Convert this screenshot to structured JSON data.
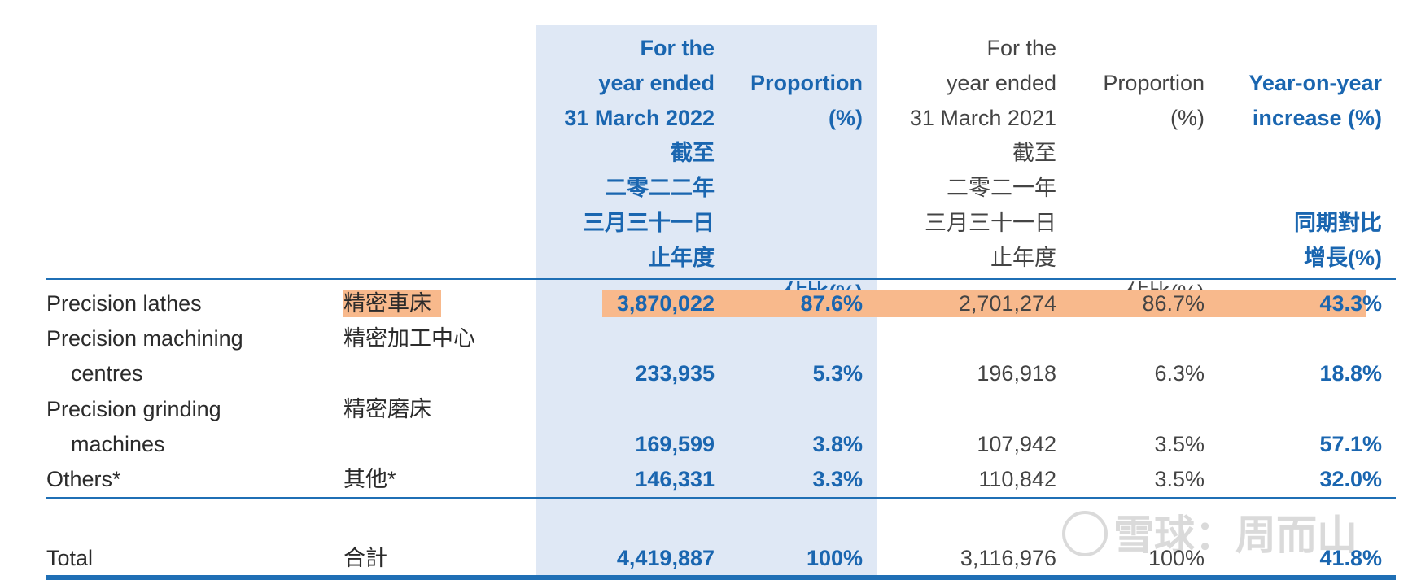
{
  "header": {
    "col_2022": "For the\nyear ended\n31 March 2022\n截至\n二零二二年\n三月三十一日\n止年度",
    "col_prop_2022": "Proportion\n(%)\n\n\n\n\n佔比(%)",
    "col_2021": "For the\nyear ended\n31 March 2021\n截至\n二零二一年\n三月三十一日\n止年度",
    "col_prop_2021": "Proportion\n(%)\n\n\n\n\n佔比(%)",
    "col_yoy": "Year-on-year\nincrease (%)\n\n\n同期對比\n增長(%)"
  },
  "rows": [
    {
      "en": "Precision lathes",
      "zh": "精密車床",
      "v2022": "3,870,022",
      "p2022": "87.6%",
      "v2021": "2,701,274",
      "p2021": "86.7%",
      "yoy": "43.3%"
    },
    {
      "en": "Precision machining",
      "en2": "centres",
      "zh": "精密加工中心",
      "v2022": "233,935",
      "p2022": "5.3%",
      "v2021": "196,918",
      "p2021": "6.3%",
      "yoy": "18.8%"
    },
    {
      "en": "Precision grinding",
      "en2": "machines",
      "zh": "精密磨床",
      "v2022": "169,599",
      "p2022": "3.8%",
      "v2021": "107,942",
      "p2021": "3.5%",
      "yoy": "57.1%"
    },
    {
      "en": "Others*",
      "zh": "其他*",
      "v2022": "146,331",
      "p2022": "3.3%",
      "v2021": "110,842",
      "p2021": "3.5%",
      "yoy": "32.0%"
    }
  ],
  "total": {
    "en": "Total",
    "zh": "合計",
    "v2022": "4,419,887",
    "p2022": "100%",
    "v2021": "3,116,976",
    "p2021": "100%",
    "yoy": "41.8%"
  },
  "watermark": "雪球：周而山",
  "colors": {
    "accent": "#1a66b0",
    "highlight": "#f8b98c",
    "shade": "#dfe8f5"
  }
}
